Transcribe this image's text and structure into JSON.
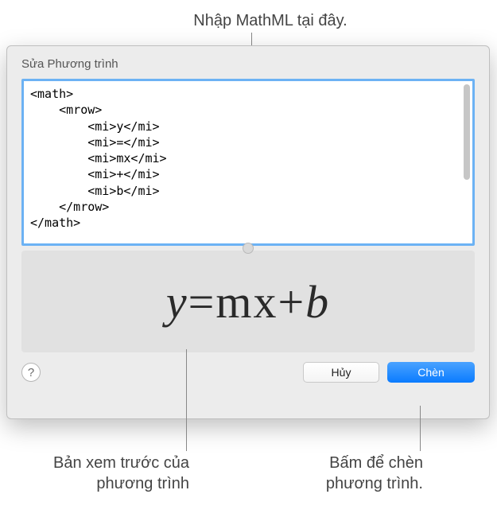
{
  "annotations": {
    "top": "Nhập MathML tại đây.",
    "bottom_left_l1": "Bản xem trước của",
    "bottom_left_l2": "phương trình",
    "bottom_right_l1": "Bấm để chèn",
    "bottom_right_l2": "phương trình."
  },
  "dialog": {
    "title": "Sửa Phương trình",
    "mathml_code": "<math>\n    <mrow>\n        <mi>y</mi>\n        <mi>=</mi>\n        <mi>mx</mi>\n        <mi>+</mi>\n        <mi>b</mi>\n    </mrow>\n</math>",
    "help_label": "?",
    "cancel_label": "Hủy",
    "insert_label": "Chèn"
  },
  "equation": {
    "y": "y",
    "eq": "=",
    "m": "m",
    "x": "x",
    "plus": "+",
    "b": "b"
  }
}
